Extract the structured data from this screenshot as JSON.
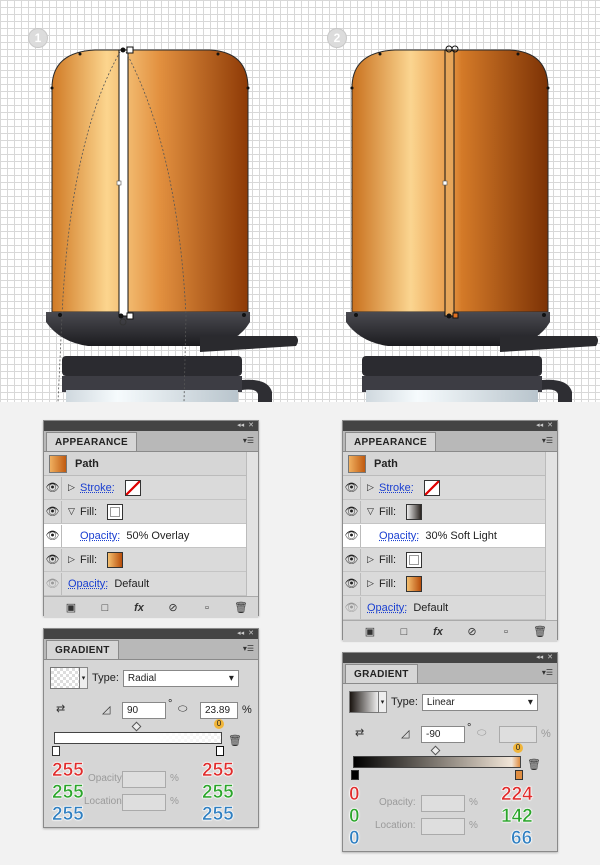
{
  "steps": [
    "1",
    "2"
  ],
  "colors": {
    "accent_link": "#1a3fd1",
    "red": "#e02c2c",
    "green": "#2ba52b",
    "blue": "#2f7fc1",
    "panel": "#d6d6d6"
  },
  "appearance_left": {
    "tab": "APPEARANCE",
    "title": "Path",
    "rows": [
      {
        "label": "Stroke:",
        "link": true,
        "swatch": "none-stroke"
      },
      {
        "label": "Fill:",
        "link": false,
        "swatch": "white"
      },
      {
        "label": "Opacity:",
        "value": "50% Overlay"
      },
      {
        "label": "Fill:",
        "link": false,
        "swatch": "orange-gradient"
      },
      {
        "label": "Opacity:",
        "value": "Default"
      }
    ],
    "footer_icons": [
      "square-icon",
      "fill-square-icon",
      "fx-icon",
      "no-icon",
      "duplicate-icon",
      "trash-icon"
    ],
    "fx_label": "fx"
  },
  "appearance_right": {
    "tab": "APPEARANCE",
    "title": "Path",
    "rows": [
      {
        "label": "Stroke:",
        "link": true,
        "swatch": "none-stroke"
      },
      {
        "label": "Fill:",
        "link": false,
        "swatch": "dark-gradient"
      },
      {
        "label": "Opacity:",
        "value": "30% Soft Light"
      },
      {
        "label": "Fill:",
        "link": false,
        "swatch": "white"
      },
      {
        "label": "Fill:",
        "link": false,
        "swatch": "orange-gradient"
      },
      {
        "label": "Opacity:",
        "value": "Default"
      }
    ],
    "fx_label": "fx"
  },
  "gradient_left": {
    "tab": "GRADIENT",
    "type_label": "Type:",
    "type_value": "Radial",
    "angle": "90",
    "aspect": "23.89",
    "pct": "%",
    "deg": "°",
    "stop_index": "0",
    "opacity_label": "Opacity:",
    "location_label": "Location:",
    "left_rgb": [
      "255",
      "255",
      "255"
    ],
    "right_rgb": [
      "255",
      "255",
      "255"
    ]
  },
  "gradient_right": {
    "tab": "GRADIENT",
    "type_label": "Type:",
    "type_value": "Linear",
    "angle": "-90",
    "pct": "%",
    "deg": "°",
    "stop_index": "0",
    "opacity_label": "Opacity:",
    "location_label": "Location:",
    "left_rgb": [
      "0",
      "0",
      "0"
    ],
    "right_rgb": [
      "224",
      "142",
      "66"
    ]
  }
}
